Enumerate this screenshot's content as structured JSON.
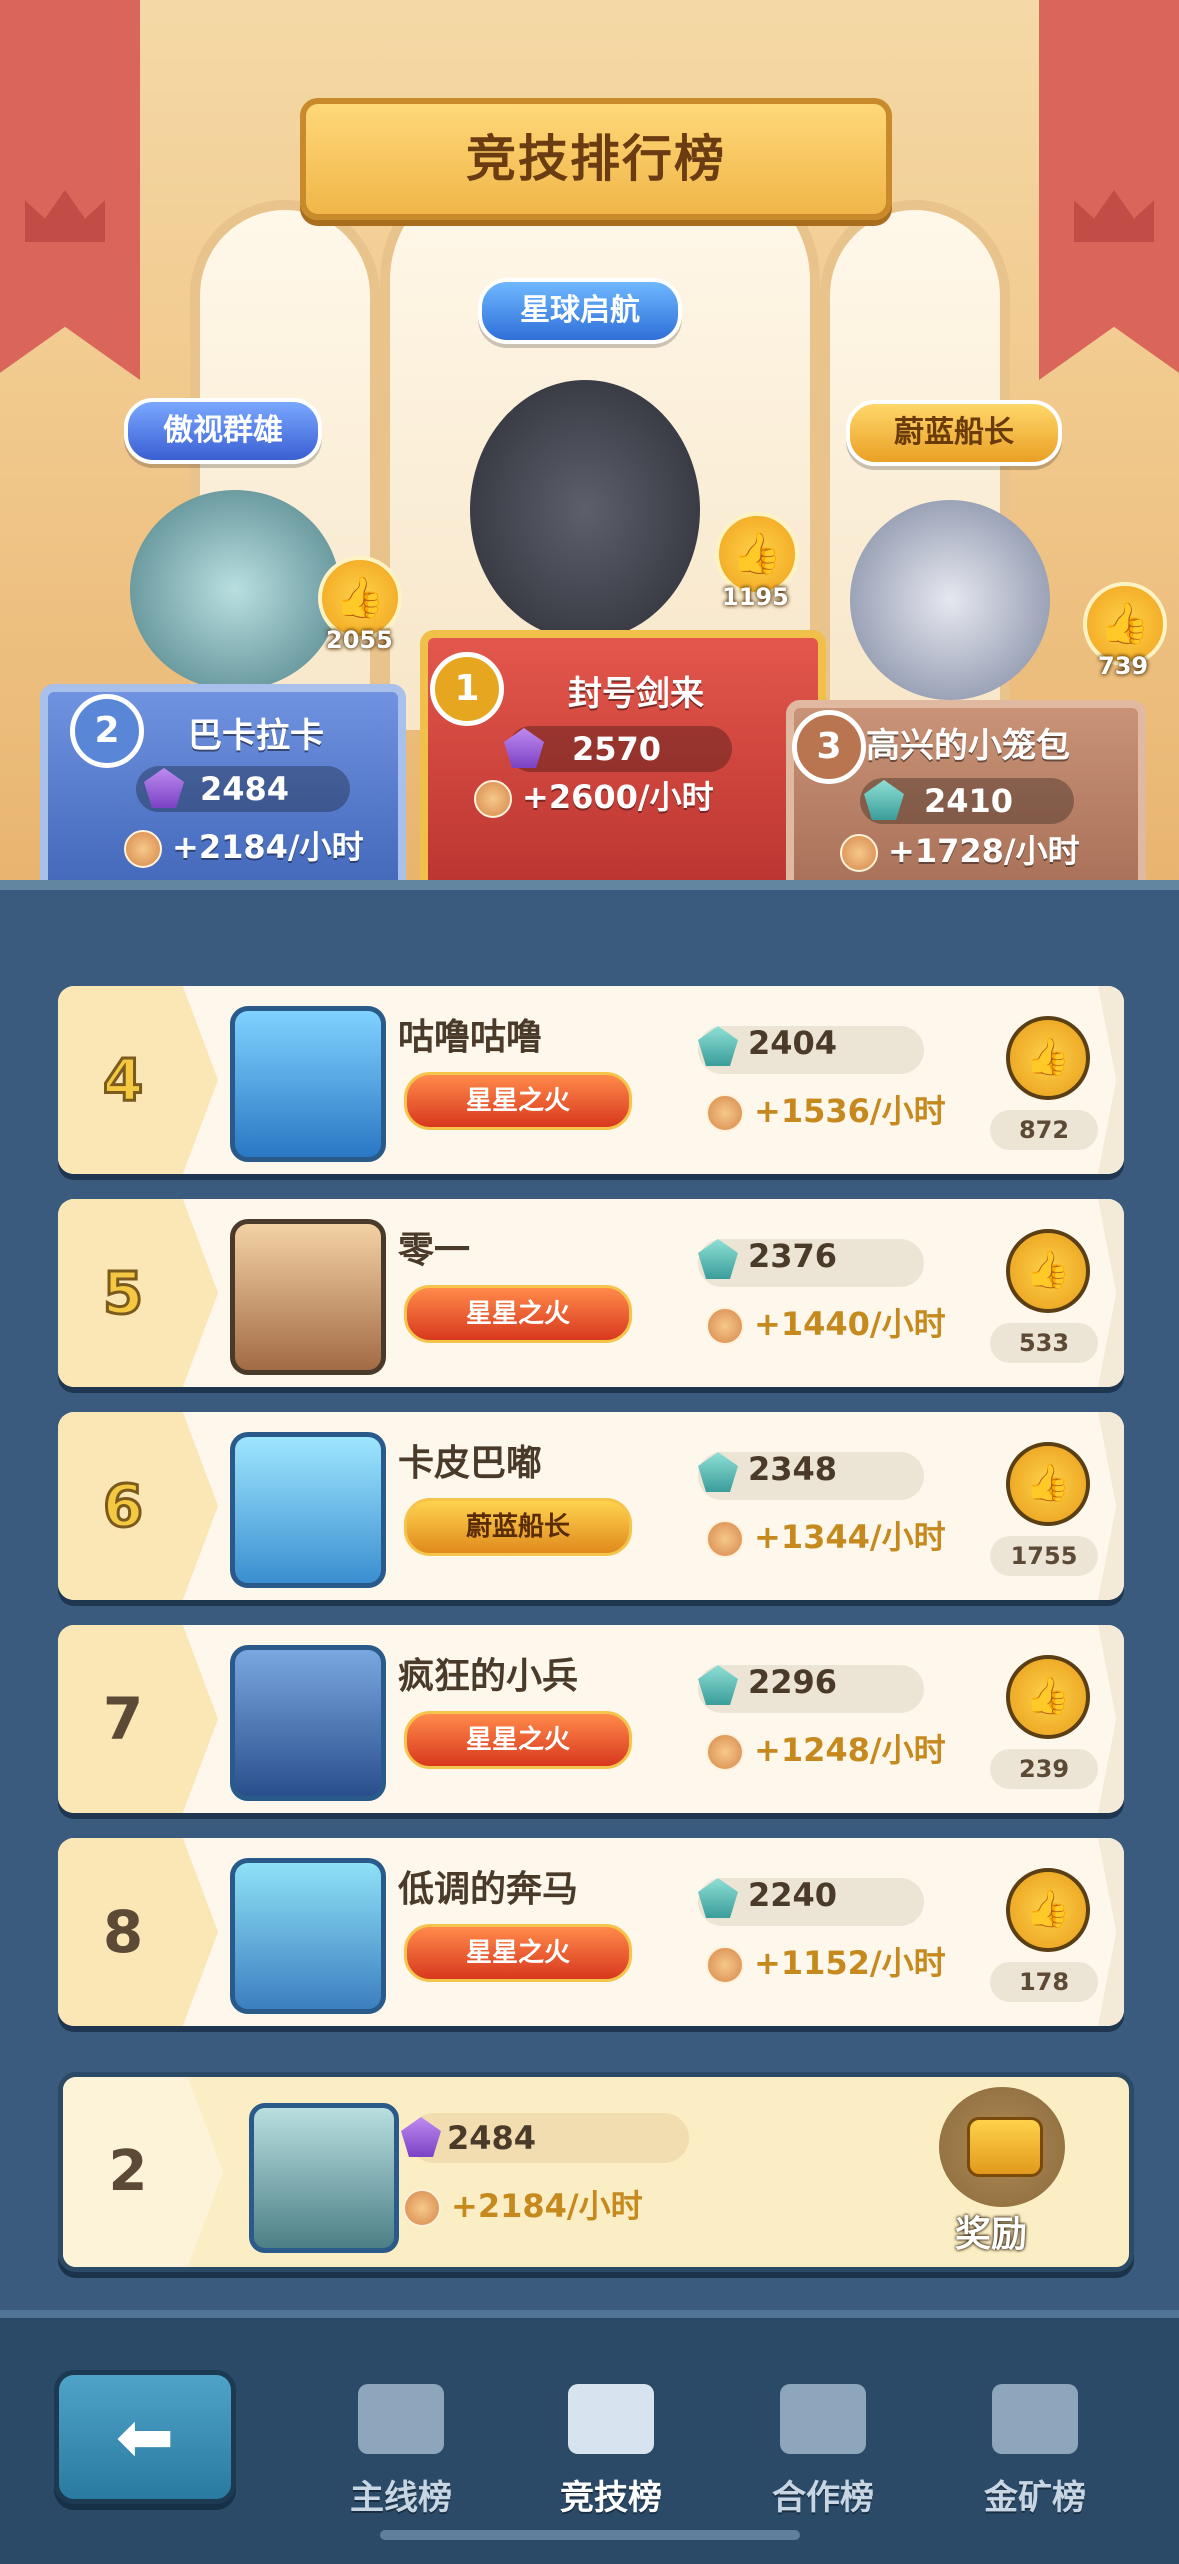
{
  "header": {
    "title": "竞技排行榜"
  },
  "podium": {
    "first": {
      "rank": "1",
      "tag": "星球启航",
      "name": "封号剑来",
      "power": "2570",
      "rate": "+2600/小时",
      "likes": "1195"
    },
    "second": {
      "rank": "2",
      "tag": "傲视群雄",
      "name": "巴卡拉卡",
      "power": "2484",
      "rate": "+2184/小时",
      "likes": "2055"
    },
    "third": {
      "rank": "3",
      "tag": "蔚蓝船长",
      "name": "高兴的小笼包",
      "power": "2410",
      "rate": "+1728/小时",
      "likes": "739"
    }
  },
  "rows": [
    {
      "rank": "4",
      "name": "咕噜咕噜",
      "title": "星星之火",
      "power": "2404",
      "rate": "+1536/小时",
      "likes": "872"
    },
    {
      "rank": "5",
      "name": "零一",
      "title": "星星之火",
      "power": "2376",
      "rate": "+1440/小时",
      "likes": "533"
    },
    {
      "rank": "6",
      "name": "卡皮巴嘟",
      "title": "蔚蓝船长",
      "power": "2348",
      "rate": "+1344/小时",
      "likes": "1755"
    },
    {
      "rank": "7",
      "name": "疯狂的小兵",
      "title": "星星之火",
      "power": "2296",
      "rate": "+1248/小时",
      "likes": "239"
    },
    {
      "rank": "8",
      "name": "低调的奔马",
      "title": "星星之火",
      "power": "2240",
      "rate": "+1152/小时",
      "likes": "178"
    }
  ],
  "me": {
    "rank": "2",
    "power": "2484",
    "rate": "+2184/小时",
    "reward_label": "奖励"
  },
  "nav": {
    "back_icon": "arrow-left-icon",
    "items": [
      {
        "label": "主线榜",
        "icon": "podium-icon"
      },
      {
        "label": "竞技榜",
        "icon": "podium-icon"
      },
      {
        "label": "合作榜",
        "icon": "handshake-icon"
      },
      {
        "label": "金矿榜",
        "icon": "minecart-icon"
      }
    ],
    "active_index": 1
  },
  "colors": {
    "panel": "#3a5b7d",
    "row_bg": "#fdf7ec",
    "gold": "#f5c842",
    "rate_text": "#c5891e"
  }
}
